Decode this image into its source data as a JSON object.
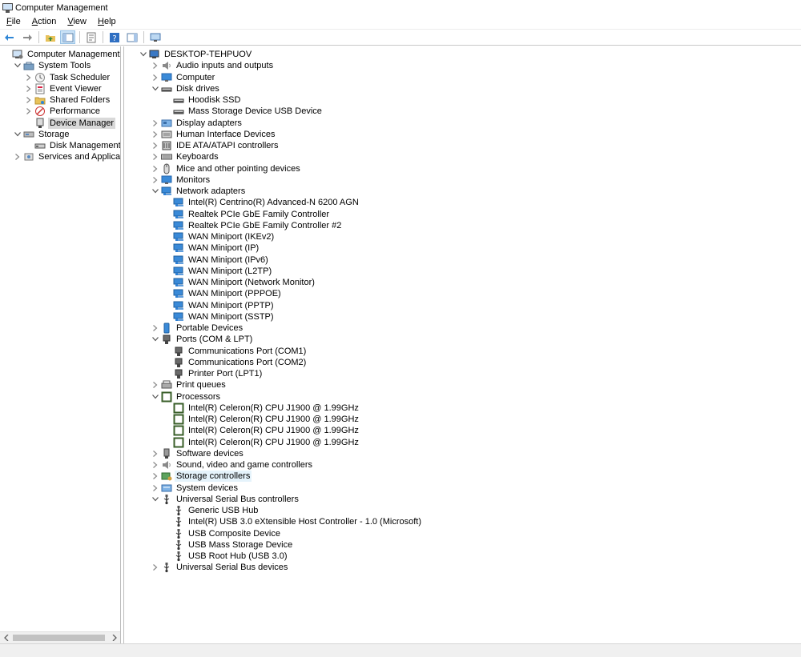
{
  "window": {
    "title": "Computer Management"
  },
  "menu": [
    {
      "key": "F",
      "rest": "ile"
    },
    {
      "key": "A",
      "rest": "ction"
    },
    {
      "key": "V",
      "rest": "iew"
    },
    {
      "key": "H",
      "rest": "elp"
    }
  ],
  "toolbar": [
    {
      "name": "back-button",
      "icon": "back-arrow-icon"
    },
    {
      "name": "forward-button",
      "icon": "forward-arrow-icon"
    },
    {
      "sep": true
    },
    {
      "name": "up-one-level-button",
      "icon": "folder-up-icon"
    },
    {
      "name": "show-hide-console-tree-button",
      "icon": "console-tree-icon",
      "pressed": true
    },
    {
      "sep": true
    },
    {
      "name": "properties-button",
      "icon": "properties-icon"
    },
    {
      "sep": true
    },
    {
      "name": "help-button",
      "icon": "help-icon"
    },
    {
      "name": "show-hide-action-pane-button",
      "icon": "action-pane-icon"
    },
    {
      "sep": true
    },
    {
      "name": "device-scan-button",
      "icon": "monitor-scan-icon"
    }
  ],
  "left_tree": [
    {
      "label": "Computer Management (Local",
      "depth": 0,
      "arrow": "none",
      "icon": "computer-management-icon"
    },
    {
      "label": "System Tools",
      "depth": 1,
      "arrow": "down",
      "icon": "toolbox-icon"
    },
    {
      "label": "Task Scheduler",
      "depth": 2,
      "arrow": "right",
      "icon": "clock-icon"
    },
    {
      "label": "Event Viewer",
      "depth": 2,
      "arrow": "right",
      "icon": "event-viewer-icon"
    },
    {
      "label": "Shared Folders",
      "depth": 2,
      "arrow": "right",
      "icon": "shared-folder-icon"
    },
    {
      "label": "Performance",
      "depth": 2,
      "arrow": "right",
      "icon": "performance-icon"
    },
    {
      "label": "Device Manager",
      "depth": 2,
      "arrow": "none",
      "icon": "device-manager-icon",
      "selected": true
    },
    {
      "label": "Storage",
      "depth": 1,
      "arrow": "down",
      "icon": "storage-icon"
    },
    {
      "label": "Disk Management",
      "depth": 2,
      "arrow": "none",
      "icon": "disk-icon"
    },
    {
      "label": "Services and Applications",
      "depth": 1,
      "arrow": "right",
      "icon": "services-icon"
    }
  ],
  "device_tree": [
    {
      "label": "DESKTOP-TEHPUOV",
      "depth": 0,
      "arrow": "down",
      "icon": "computer-icon"
    },
    {
      "label": "Audio inputs and outputs",
      "depth": 1,
      "arrow": "right",
      "icon": "speaker-icon"
    },
    {
      "label": "Computer",
      "depth": 1,
      "arrow": "right",
      "icon": "monitor-icon"
    },
    {
      "label": "Disk drives",
      "depth": 1,
      "arrow": "down",
      "icon": "disk-drive-icon"
    },
    {
      "label": "Hoodisk SSD",
      "depth": 2,
      "arrow": "none",
      "icon": "disk-drive-icon"
    },
    {
      "label": "Mass Storage Device USB Device",
      "depth": 2,
      "arrow": "none",
      "icon": "disk-drive-icon"
    },
    {
      "label": "Display adapters",
      "depth": 1,
      "arrow": "right",
      "icon": "display-adapter-icon"
    },
    {
      "label": "Human Interface Devices",
      "depth": 1,
      "arrow": "right",
      "icon": "hid-icon"
    },
    {
      "label": "IDE ATA/ATAPI controllers",
      "depth": 1,
      "arrow": "right",
      "icon": "ide-controller-icon"
    },
    {
      "label": "Keyboards",
      "depth": 1,
      "arrow": "right",
      "icon": "keyboard-icon"
    },
    {
      "label": "Mice and other pointing devices",
      "depth": 1,
      "arrow": "right",
      "icon": "mouse-icon"
    },
    {
      "label": "Monitors",
      "depth": 1,
      "arrow": "right",
      "icon": "monitor-icon"
    },
    {
      "label": "Network adapters",
      "depth": 1,
      "arrow": "down",
      "icon": "network-adapter-icon"
    },
    {
      "label": "Intel(R) Centrino(R) Advanced-N 6200 AGN",
      "depth": 2,
      "arrow": "none",
      "icon": "network-adapter-icon"
    },
    {
      "label": "Realtek PCIe GbE Family Controller",
      "depth": 2,
      "arrow": "none",
      "icon": "network-adapter-icon"
    },
    {
      "label": "Realtek PCIe GbE Family Controller #2",
      "depth": 2,
      "arrow": "none",
      "icon": "network-adapter-icon"
    },
    {
      "label": "WAN Miniport (IKEv2)",
      "depth": 2,
      "arrow": "none",
      "icon": "network-adapter-icon"
    },
    {
      "label": "WAN Miniport (IP)",
      "depth": 2,
      "arrow": "none",
      "icon": "network-adapter-icon"
    },
    {
      "label": "WAN Miniport (IPv6)",
      "depth": 2,
      "arrow": "none",
      "icon": "network-adapter-icon"
    },
    {
      "label": "WAN Miniport (L2TP)",
      "depth": 2,
      "arrow": "none",
      "icon": "network-adapter-icon"
    },
    {
      "label": "WAN Miniport (Network Monitor)",
      "depth": 2,
      "arrow": "none",
      "icon": "network-adapter-icon"
    },
    {
      "label": "WAN Miniport (PPPOE)",
      "depth": 2,
      "arrow": "none",
      "icon": "network-adapter-icon"
    },
    {
      "label": "WAN Miniport (PPTP)",
      "depth": 2,
      "arrow": "none",
      "icon": "network-adapter-icon"
    },
    {
      "label": "WAN Miniport (SSTP)",
      "depth": 2,
      "arrow": "none",
      "icon": "network-adapter-icon"
    },
    {
      "label": "Portable Devices",
      "depth": 1,
      "arrow": "right",
      "icon": "portable-device-icon"
    },
    {
      "label": "Ports (COM & LPT)",
      "depth": 1,
      "arrow": "down",
      "icon": "port-icon"
    },
    {
      "label": "Communications Port (COM1)",
      "depth": 2,
      "arrow": "none",
      "icon": "port-icon"
    },
    {
      "label": "Communications Port (COM2)",
      "depth": 2,
      "arrow": "none",
      "icon": "port-icon"
    },
    {
      "label": "Printer Port (LPT1)",
      "depth": 2,
      "arrow": "none",
      "icon": "port-icon"
    },
    {
      "label": "Print queues",
      "depth": 1,
      "arrow": "right",
      "icon": "printer-icon"
    },
    {
      "label": "Processors",
      "depth": 1,
      "arrow": "down",
      "icon": "processor-icon"
    },
    {
      "label": "Intel(R) Celeron(R) CPU  J1900  @ 1.99GHz",
      "depth": 2,
      "arrow": "none",
      "icon": "processor-icon"
    },
    {
      "label": "Intel(R) Celeron(R) CPU  J1900  @ 1.99GHz",
      "depth": 2,
      "arrow": "none",
      "icon": "processor-icon"
    },
    {
      "label": "Intel(R) Celeron(R) CPU  J1900  @ 1.99GHz",
      "depth": 2,
      "arrow": "none",
      "icon": "processor-icon"
    },
    {
      "label": "Intel(R) Celeron(R) CPU  J1900  @ 1.99GHz",
      "depth": 2,
      "arrow": "none",
      "icon": "processor-icon"
    },
    {
      "label": "Software devices",
      "depth": 1,
      "arrow": "right",
      "icon": "software-device-icon"
    },
    {
      "label": "Sound, video and game controllers",
      "depth": 1,
      "arrow": "right",
      "icon": "speaker-icon"
    },
    {
      "label": "Storage controllers",
      "depth": 1,
      "arrow": "right",
      "icon": "storage-controller-icon",
      "hover": true
    },
    {
      "label": "System devices",
      "depth": 1,
      "arrow": "right",
      "icon": "system-device-icon"
    },
    {
      "label": "Universal Serial Bus controllers",
      "depth": 1,
      "arrow": "down",
      "icon": "usb-icon"
    },
    {
      "label": "Generic USB Hub",
      "depth": 2,
      "arrow": "none",
      "icon": "usb-icon"
    },
    {
      "label": "Intel(R) USB 3.0 eXtensible Host Controller - 1.0 (Microsoft)",
      "depth": 2,
      "arrow": "none",
      "icon": "usb-icon"
    },
    {
      "label": "USB Composite Device",
      "depth": 2,
      "arrow": "none",
      "icon": "usb-icon"
    },
    {
      "label": "USB Mass Storage Device",
      "depth": 2,
      "arrow": "none",
      "icon": "usb-icon"
    },
    {
      "label": "USB Root Hub (USB 3.0)",
      "depth": 2,
      "arrow": "none",
      "icon": "usb-icon"
    },
    {
      "label": "Universal Serial Bus devices",
      "depth": 1,
      "arrow": "right",
      "icon": "usb-icon"
    }
  ],
  "colors": {
    "selection": "#d9d9d9",
    "hover": "#e5f3fb",
    "pane_border": "#bdbdbd",
    "network_blue": "#2d7fd3",
    "processor_green": "#3a5f2a"
  }
}
